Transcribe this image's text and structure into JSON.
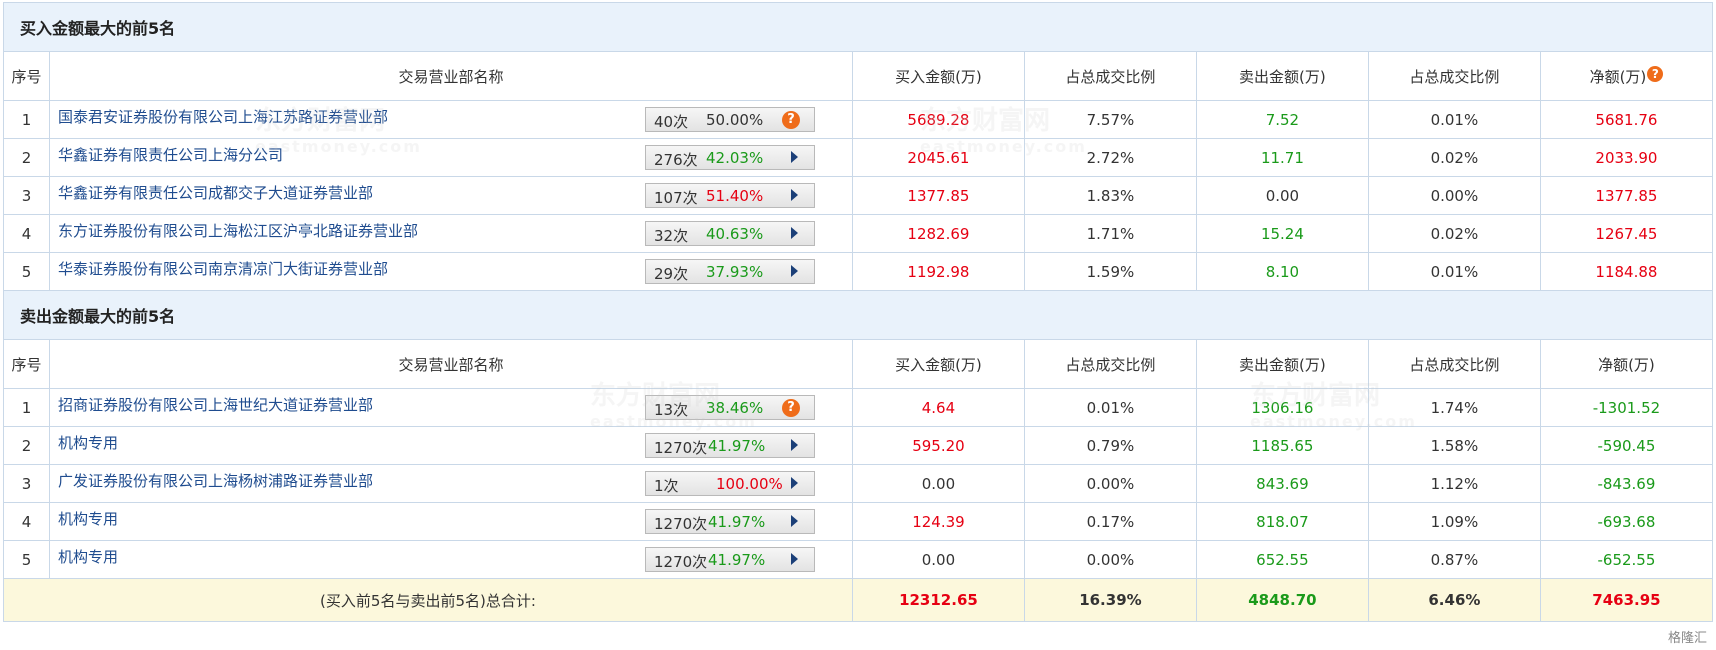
{
  "buy_section": {
    "title": "买入金额最大的前5名",
    "headers": {
      "seq": "序号",
      "name": "交易营业部名称",
      "buy_amt": "买入金额(万)",
      "buy_ratio": "占总成交比例",
      "sell_amt": "卖出金额(万)",
      "sell_ratio": "占总成交比例",
      "net": "净额(万)"
    },
    "rows": [
      {
        "seq": "1",
        "name": "国泰君安证券股份有限公司上海江苏路证券营业部",
        "count": "40次",
        "pct": "50.00%",
        "buy": "5689.28",
        "buy_ratio": "7.57%",
        "sell": "7.52",
        "sell_ratio": "0.01%",
        "net": "5681.76"
      },
      {
        "seq": "2",
        "name": "华鑫证券有限责任公司上海分公司",
        "count": "276次",
        "pct": "42.03%",
        "buy": "2045.61",
        "buy_ratio": "2.72%",
        "sell": "11.71",
        "sell_ratio": "0.02%",
        "net": "2033.90"
      },
      {
        "seq": "3",
        "name": "华鑫证券有限责任公司成都交子大道证券营业部",
        "count": "107次",
        "pct": "51.40%",
        "buy": "1377.85",
        "buy_ratio": "1.83%",
        "sell": "0.00",
        "sell_ratio": "0.00%",
        "net": "1377.85"
      },
      {
        "seq": "4",
        "name": "东方证券股份有限公司上海松江区沪亭北路证券营业部",
        "count": "32次",
        "pct": "40.63%",
        "buy": "1282.69",
        "buy_ratio": "1.71%",
        "sell": "15.24",
        "sell_ratio": "0.02%",
        "net": "1267.45"
      },
      {
        "seq": "5",
        "name": "华泰证券股份有限公司南京清凉门大街证券营业部",
        "count": "29次",
        "pct": "37.93%",
        "buy": "1192.98",
        "buy_ratio": "1.59%",
        "sell": "8.10",
        "sell_ratio": "0.01%",
        "net": "1184.88"
      }
    ]
  },
  "sell_section": {
    "title": "卖出金额最大的前5名",
    "headers": {
      "seq": "序号",
      "name": "交易营业部名称",
      "buy_amt": "买入金额(万)",
      "buy_ratio": "占总成交比例",
      "sell_amt": "卖出金额(万)",
      "sell_ratio": "占总成交比例",
      "net": "净额(万)"
    },
    "rows": [
      {
        "seq": "1",
        "name": "招商证券股份有限公司上海世纪大道证券营业部",
        "count": "13次",
        "pct": "38.46%",
        "buy": "4.64",
        "buy_ratio": "0.01%",
        "sell": "1306.16",
        "sell_ratio": "1.74%",
        "net": "-1301.52"
      },
      {
        "seq": "2",
        "name": "机构专用",
        "count": "1270次",
        "pct": "41.97%",
        "buy": "595.20",
        "buy_ratio": "0.79%",
        "sell": "1185.65",
        "sell_ratio": "1.58%",
        "net": "-590.45"
      },
      {
        "seq": "3",
        "name": "广发证券股份有限公司上海杨树浦路证券营业部",
        "count": "1次",
        "pct": "100.00%",
        "buy": "0.00",
        "buy_ratio": "0.00%",
        "sell": "843.69",
        "sell_ratio": "1.12%",
        "net": "-843.69"
      },
      {
        "seq": "4",
        "name": "机构专用",
        "count": "1270次",
        "pct": "41.97%",
        "buy": "124.39",
        "buy_ratio": "0.17%",
        "sell": "818.07",
        "sell_ratio": "1.09%",
        "net": "-693.68"
      },
      {
        "seq": "5",
        "name": "机构专用",
        "count": "1270次",
        "pct": "41.97%",
        "buy": "0.00",
        "buy_ratio": "0.00%",
        "sell": "652.55",
        "sell_ratio": "0.87%",
        "net": "-652.55"
      }
    ]
  },
  "total": {
    "label": "(买入前5名与卖出前5名)总合计:",
    "buy": "12312.65",
    "buy_ratio": "16.39%",
    "sell": "4848.70",
    "sell_ratio": "6.46%",
    "net": "7463.95"
  },
  "watermark": {
    "cn": "东方财富网",
    "en": "eastmoney.com"
  },
  "badge": "格隆汇",
  "colors": {
    "positive": "#e60012",
    "negative": "#1a9a1a",
    "link": "#1f4c8f",
    "section_bg": "#e9f2fb",
    "total_bg": "#fcf8dc",
    "icon_orange": "#ef6c1a"
  }
}
